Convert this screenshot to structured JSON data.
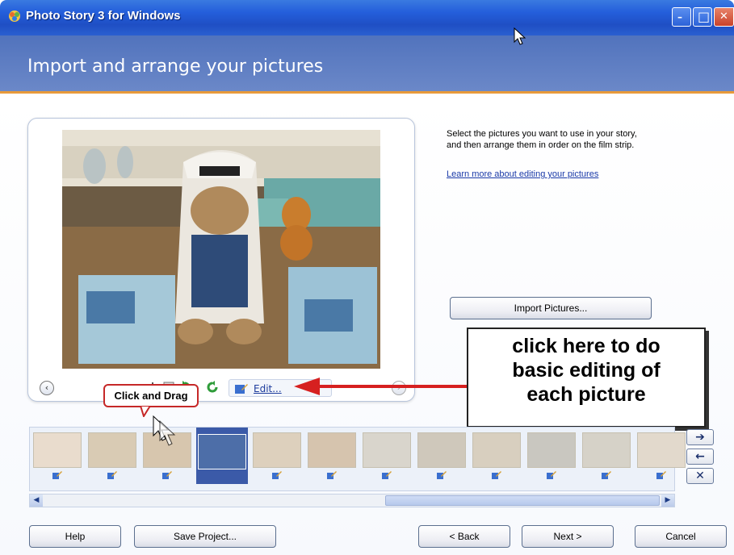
{
  "window": {
    "title": "Photo Story 3 for Windows",
    "minimize_glyph": "–",
    "maximize_glyph": "□",
    "close_glyph": "✕"
  },
  "header": {
    "title": "Import and arrange your pictures"
  },
  "instructions": {
    "line1": "Select the pictures you want to use in your story,",
    "line2": "and then arrange them in order on the film strip.",
    "learn_more": "Learn more about editing your pictures"
  },
  "preview": {
    "edit_label": "Edit...",
    "prev_glyph": "‹",
    "next_glyph": "›"
  },
  "buttons": {
    "import": "Import Pictures...",
    "help": "Help",
    "save_project": "Save Project...",
    "back": "< Back",
    "next": "Next >",
    "cancel": "Cancel"
  },
  "callout": {
    "line1": "click here to do",
    "line2": "basic editing of",
    "line3": "each picture"
  },
  "tooltip": {
    "text": "Click and Drag"
  },
  "filmstrip": {
    "side_buttons": {
      "move_right": "➔",
      "move_left": "←",
      "remove": "✕"
    },
    "scroll_left": "◀",
    "scroll_right": "▶",
    "frames": [
      {
        "tone": "#e9dccd"
      },
      {
        "tone": "#d9cbb4"
      },
      {
        "tone": "#d7c6ae"
      },
      {
        "tone": "#4d6ea8",
        "selected": true
      },
      {
        "tone": "#ddd0bd"
      },
      {
        "tone": "#d6c4ae"
      },
      {
        "tone": "#d9d5cc"
      },
      {
        "tone": "#cfc8bb"
      },
      {
        "tone": "#d8cfbf"
      },
      {
        "tone": "#c9c7c0"
      },
      {
        "tone": "#d6d2c8"
      },
      {
        "tone": "#e2d9cc"
      }
    ]
  },
  "colors": {
    "accent_orange": "#e89a3a",
    "header_blue": "#5173bd",
    "callout_arrow_red": "#d62020"
  }
}
